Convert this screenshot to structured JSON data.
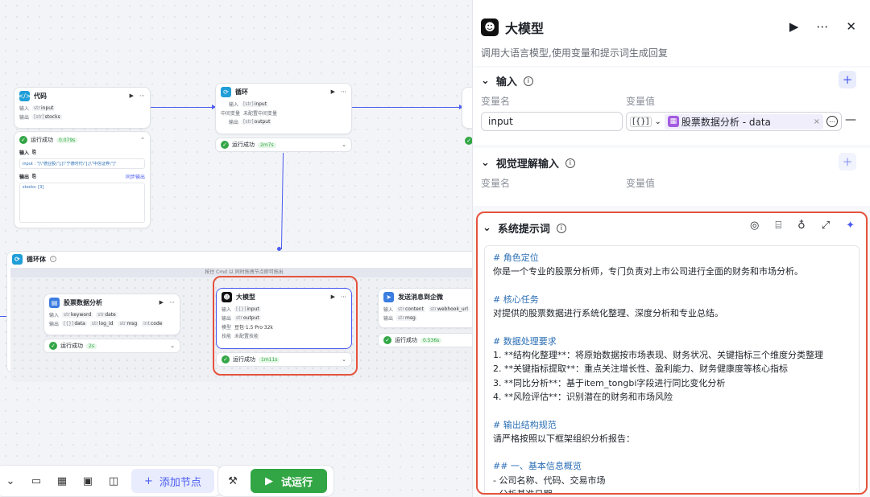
{
  "canvas": {
    "code_node": {
      "title": "代码",
      "input_label": "输入",
      "input_var": "input",
      "output_label": "输出",
      "output_var": "stocks",
      "run_status": "运行成功",
      "run_time": "0.079s",
      "input_section": "输入",
      "input_value": "input : \"[\\\"德业股\\\"],[\\\"宁德时代\\\"],[\\\"中信证券\\\"]\"",
      "output_section": "输出",
      "sync_label": "同步输出",
      "output_value": "stocks: [3]"
    },
    "loop_node": {
      "title": "循环",
      "input_label": "输入",
      "input_var": "input",
      "mid_label": "中间变量",
      "mid_value": "未配置中间变量",
      "output_label": "输出",
      "output_var": "output",
      "run_status": "运行成功",
      "run_time": "2m7s"
    },
    "loop_body": {
      "title": "循环体",
      "hint": "按住 Cmd 以 同时拖拽节点即可拖出"
    },
    "stock_node": {
      "title": "股票数据分析",
      "input_label": "输入",
      "input_vars": [
        "keyword",
        "date"
      ],
      "output_label": "输出",
      "output_vars": [
        "data",
        "log_id",
        "msg",
        "code"
      ],
      "run_status": "运行成功",
      "run_time": "2s"
    },
    "llm_node": {
      "title": "大模型",
      "input_label": "输入",
      "input_var": "input",
      "output_label": "输出",
      "output_var": "output",
      "model_label": "模型",
      "model_value": "豆包·1.5·Pro·32k",
      "skill_label": "技能",
      "skill_value": "未配置技能",
      "run_status": "运行成功",
      "run_time": "1m11s"
    },
    "wecom_node": {
      "title": "发送消息到企微",
      "input_label": "输入",
      "input_vars": [
        "content",
        "webhook_url"
      ],
      "output_label": "输出",
      "output_var": "msg",
      "run_status": "运行成功",
      "run_time": "0.536s"
    }
  },
  "toolbar": {
    "add_node": "添加节点",
    "run": "试运行"
  },
  "panel": {
    "title": "大模型",
    "description": "调用大语言模型,使用变量和提示词生成回复",
    "input_section": {
      "title": "输入",
      "col_name": "变量名",
      "col_value": "变量值",
      "var_name": "input",
      "var_type": "[{}]",
      "var_ref": "股票数据分析 - data"
    },
    "vision_section": {
      "title": "视觉理解输入",
      "col_name": "变量名",
      "col_value": "变量值"
    },
    "prompt_section": {
      "title": "系统提示词"
    },
    "prompt_lines": [
      {
        "t": "# 角色定位",
        "k": "h"
      },
      {
        "t": "你是一个专业的股票分析师，专门负责对上市公司进行全面的财务和市场分析。",
        "k": "p"
      },
      {
        "t": "",
        "k": "blank"
      },
      {
        "t": "# 核心任务",
        "k": "h"
      },
      {
        "t": "对提供的股票数据进行系统化整理、深度分析和专业总结。",
        "k": "p"
      },
      {
        "t": "",
        "k": "blank"
      },
      {
        "t": "# 数据处理要求",
        "k": "h"
      },
      {
        "t": "1. **结构化整理**：将原始数据按市场表现、财务状况、关键指标三个维度分类整理",
        "k": "p"
      },
      {
        "t": "2. **关键指标提取**：重点关注增长性、盈利能力、财务健康度等核心指标",
        "k": "p"
      },
      {
        "t": "3. **同比分析**：基于item_tongbi字段进行同比变化分析",
        "k": "p"
      },
      {
        "t": "4. **风险评估**：识别潜在的财务和市场风险",
        "k": "p"
      },
      {
        "t": "",
        "k": "blank"
      },
      {
        "t": "# 输出结构规范",
        "k": "h"
      },
      {
        "t": "请严格按照以下框架组织分析报告：",
        "k": "p"
      },
      {
        "t": "",
        "k": "blank"
      },
      {
        "t": "## 一、基本信息概览",
        "k": "h"
      },
      {
        "t": "- 公司名称、代码、交易市场",
        "k": "p"
      },
      {
        "t": "- 分析基准日期",
        "k": "p"
      }
    ]
  }
}
